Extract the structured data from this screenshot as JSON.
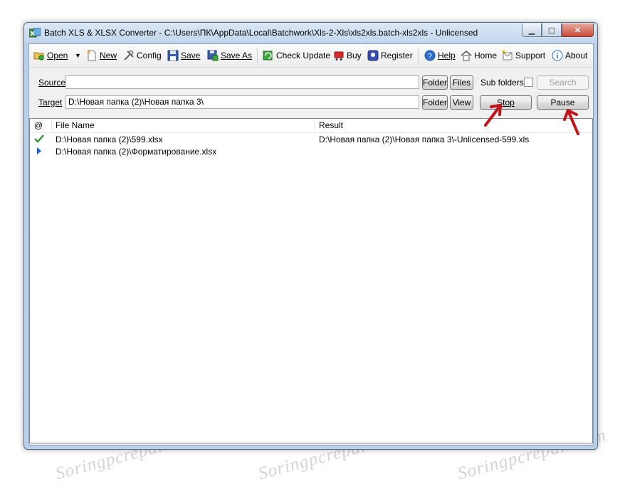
{
  "window": {
    "title": "Batch XLS & XLSX Converter - C:\\Users\\ПК\\AppData\\Local\\Batchwork\\Xls-2-Xls\\xls2xls.batch-xls2xls - Unlicensed",
    "controls": {
      "minimize": "▁",
      "maximize": "▢",
      "close": "✕"
    }
  },
  "toolbar": {
    "open": "Open",
    "new": "New",
    "config": "Config",
    "save": "Save",
    "save_as": "Save As",
    "check_update": "Check Update",
    "buy": "Buy",
    "register": "Register",
    "help": "Help",
    "home": "Home",
    "support": "Support",
    "about": "About"
  },
  "form": {
    "source_label": "Source",
    "source_value": "",
    "target_label": "Target",
    "target_value": "D:\\Новая папка (2)\\Новая папка 3\\",
    "folder_label": "Folder",
    "files_label": "Files",
    "view_label": "View",
    "subfolders_label": "Sub folders",
    "subfolders_checked": false,
    "search_label": "Search",
    "stop_label": "Stop",
    "pause_label": "Pause"
  },
  "list": {
    "columns": [
      "@",
      "File Name",
      "Result"
    ],
    "rows": [
      {
        "status_icon": "check-icon",
        "file": "D:\\Новая папка (2)\\599.xlsx",
        "result": "D:\\Новая папка (2)\\Новая папка 3\\-Unlicensed-599.xls"
      },
      {
        "status_icon": "play-arrow-icon",
        "file": "D:\\Новая папка (2)\\Форматирование.xlsx",
        "result": ""
      }
    ]
  },
  "watermark": "Soringpcrepair.com",
  "colors": {
    "arrow": "#c0141b",
    "title_bg": "#c3d6ec",
    "close_btn": "#c74a38",
    "check": "#2e8b2e",
    "play": "#1f5fbf"
  }
}
